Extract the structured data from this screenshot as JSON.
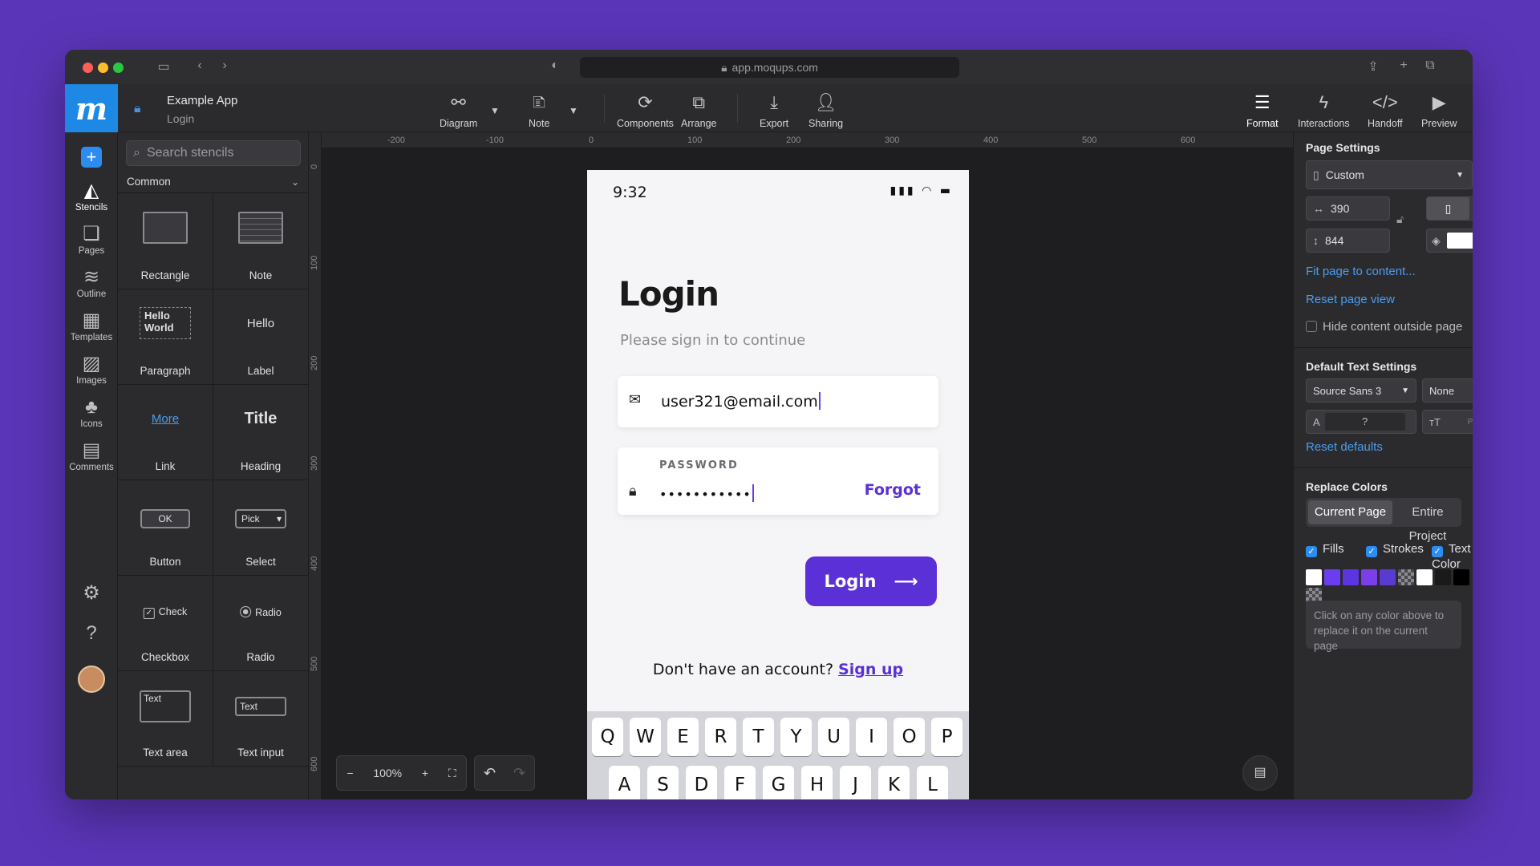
{
  "browser": {
    "url": "app.moqups.com"
  },
  "app": {
    "logo": "m",
    "title": "Example App",
    "page": "Login"
  },
  "toolbar": {
    "diagram": "Diagram",
    "note": "Note",
    "components": "Components",
    "arrange": "Arrange",
    "export": "Export",
    "sharing": "Sharing",
    "format": "Format",
    "interactions": "Interactions",
    "handoff": "Handoff",
    "preview": "Preview"
  },
  "rail": {
    "stencils": "Stencils",
    "pages": "Pages",
    "outline": "Outline",
    "templates": "Templates",
    "images": "Images",
    "icons": "Icons",
    "comments": "Comments"
  },
  "stencils": {
    "search_placeholder": "Search stencils",
    "group": "Common",
    "items": [
      {
        "label": "Rectangle"
      },
      {
        "label": "Note"
      },
      {
        "label": "Paragraph",
        "preview": "Hello World"
      },
      {
        "label": "Label",
        "preview": "Hello"
      },
      {
        "label": "Link",
        "preview": "More"
      },
      {
        "label": "Heading",
        "preview": "Title"
      },
      {
        "label": "Button",
        "preview": "OK"
      },
      {
        "label": "Select",
        "preview": "Pick"
      },
      {
        "label": "Checkbox",
        "preview": "Check"
      },
      {
        "label": "Radio",
        "preview": "Radio"
      },
      {
        "label": "Text area",
        "preview": "Text"
      },
      {
        "label": "Text input",
        "preview": "Text"
      }
    ]
  },
  "ruler": {
    "top": [
      "-200",
      "-100",
      "0",
      "100",
      "200",
      "300",
      "400",
      "500",
      "600"
    ],
    "left": [
      "0",
      "100",
      "200",
      "300",
      "400",
      "500",
      "600"
    ]
  },
  "phone": {
    "time": "9:32",
    "title": "Login",
    "subtitle": "Please sign in to continue",
    "email": "user321@email.com",
    "password_label": "PASSWORD",
    "password": "•••••••••••",
    "forgot": "Forgot",
    "login_button": "Login",
    "signup_prompt": "Don't have an account?",
    "signup_link": "Sign up",
    "keys_row1": [
      "Q",
      "W",
      "E",
      "R",
      "T",
      "Y",
      "U",
      "I",
      "O",
      "P"
    ],
    "keys_row2": [
      "A",
      "S",
      "D",
      "F",
      "G",
      "H",
      "J",
      "K",
      "L"
    ]
  },
  "zoom": {
    "level": "100%"
  },
  "right_panel": {
    "page_settings": "Page Settings",
    "preset": "Custom",
    "width": "390",
    "height": "844",
    "fit_link": "Fit page to content...",
    "reset_view": "Reset page view",
    "hide_outside": "Hide content outside page",
    "text_settings": "Default Text Settings",
    "font": "Source Sans 3",
    "font_style": "None",
    "font_size": "?",
    "unit": "PX",
    "reset_defaults": "Reset defaults",
    "replace_colors": "Replace Colors",
    "seg_current": "Current Page",
    "seg_entire": "Entire Project",
    "fills": "Fills",
    "strokes": "Strokes",
    "text_color": "Text Color",
    "hint": "Click on any color above to replace it on the current page",
    "swatches": [
      "#ffffff",
      "#6a3ef0",
      "#5b35e0",
      "#7b3ee8",
      "#5a3ad0",
      "checker",
      "#ffffff",
      "#1a1a1a",
      "#000000",
      "checker"
    ]
  }
}
